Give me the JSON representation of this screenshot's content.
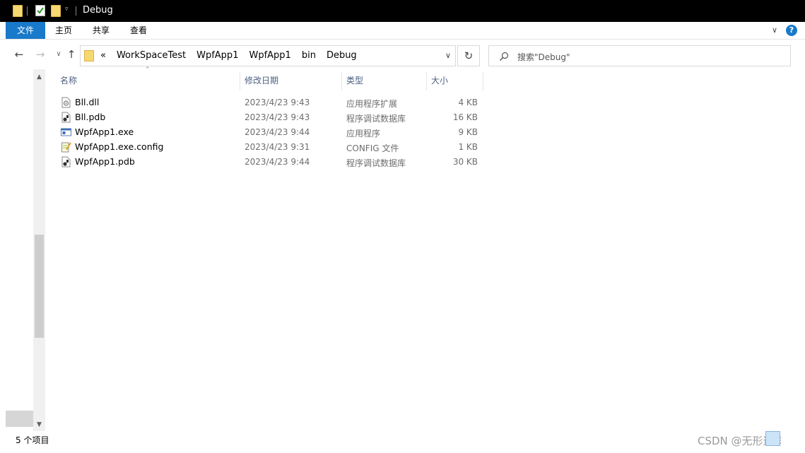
{
  "window": {
    "title": "Debug"
  },
  "ribbon": {
    "tabs": [
      "文件",
      "主页",
      "共享",
      "查看"
    ]
  },
  "address": {
    "overflow": "«",
    "crumbs": [
      "WorkSpaceTest",
      "WpfApp1",
      "WpfApp1",
      "bin",
      "Debug"
    ]
  },
  "search": {
    "placeholder": "搜索\"Debug\""
  },
  "columns": {
    "name": "名称",
    "date": "修改日期",
    "type": "类型",
    "size": "大小"
  },
  "files": [
    {
      "name": "Bll.dll",
      "date": "2023/4/23 9:43",
      "type": "应用程序扩展",
      "size": "4 KB",
      "icon": "dll-file-icon"
    },
    {
      "name": "Bll.pdb",
      "date": "2023/4/23 9:43",
      "type": "程序调试数据库",
      "size": "16 KB",
      "icon": "pdb-file-icon"
    },
    {
      "name": "WpfApp1.exe",
      "date": "2023/4/23 9:44",
      "type": "应用程序",
      "size": "9 KB",
      "icon": "exe-file-icon"
    },
    {
      "name": "WpfApp1.exe.config",
      "date": "2023/4/23 9:31",
      "type": "CONFIG 文件",
      "size": "1 KB",
      "icon": "config-file-icon"
    },
    {
      "name": "WpfApp1.pdb",
      "date": "2023/4/23 9:44",
      "type": "程序调试数据库",
      "size": "30 KB",
      "icon": "pdb-file-icon"
    }
  ],
  "status": {
    "count": "5 个项目",
    "watermark": "CSDN @无形道长"
  },
  "colors": {
    "accent": "#1979ca",
    "header_text": "#4d6082",
    "folder": "#f6d870"
  }
}
